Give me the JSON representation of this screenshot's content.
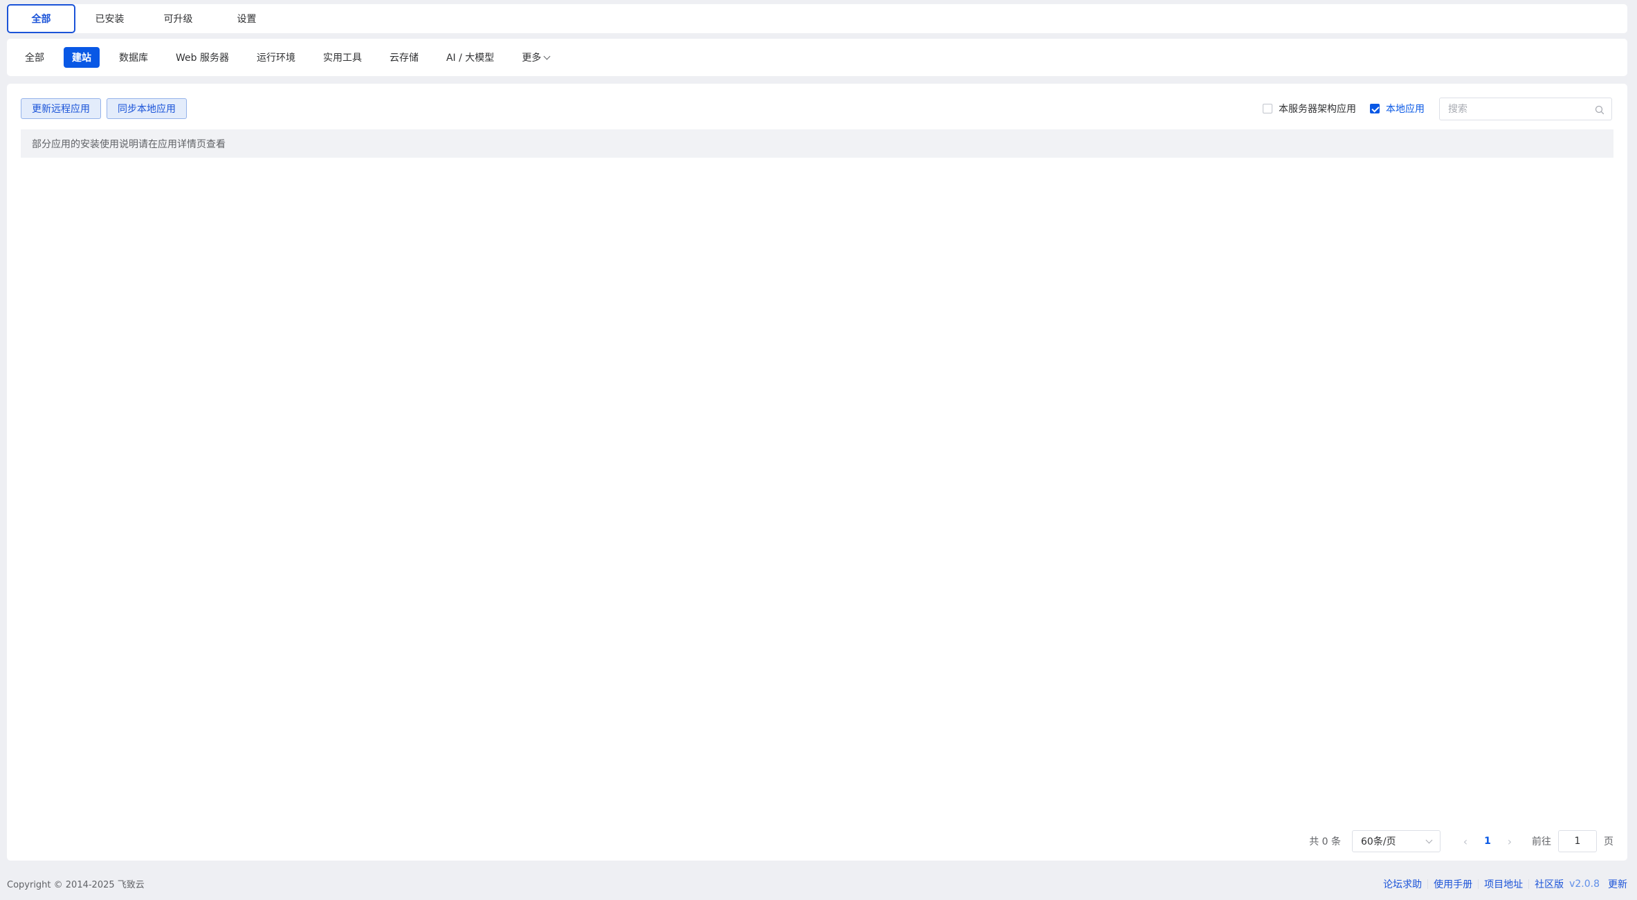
{
  "top_tabs": [
    "全部",
    "已安装",
    "可升级",
    "设置"
  ],
  "categories": [
    "全部",
    "建站",
    "数据库",
    "Web 服务器",
    "运行环境",
    "实用工具",
    "云存储",
    "AI / 大模型",
    "更多"
  ],
  "actions": {
    "update_remote": "更新远程应用",
    "sync_local": "同步本地应用"
  },
  "filters": {
    "arch_label": "本服务器架构应用",
    "arch_checked": false,
    "local_label": "本地应用",
    "local_checked": true
  },
  "search": {
    "placeholder": "搜索",
    "value": ""
  },
  "notice": "部分应用的安装使用说明请在应用详情页查看",
  "pagination": {
    "total": "共 0 条",
    "page_size": "60条/页",
    "current": "1",
    "goto_prefix": "前往",
    "goto_value": "1",
    "goto_suffix": "页"
  },
  "footer": {
    "copyright": "Copyright © 2014-2025 飞致云",
    "links": [
      "论坛求助",
      "使用手册",
      "项目地址",
      "社区版"
    ],
    "version": "v2.0.8",
    "update": "更新"
  },
  "colors": {
    "accent": "#0958e5",
    "link": "#1a53d8"
  }
}
